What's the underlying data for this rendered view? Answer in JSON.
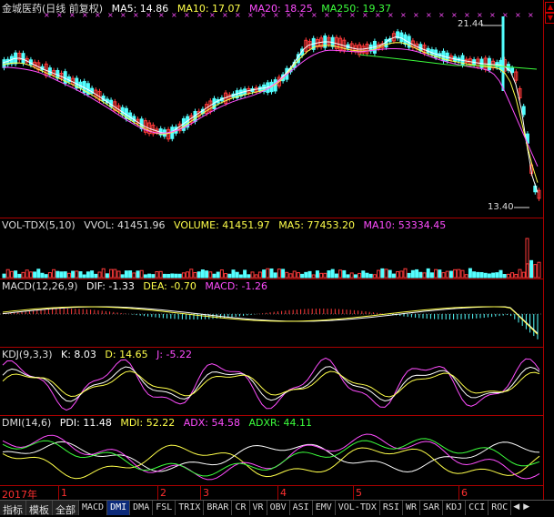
{
  "main_panel": {
    "stock_name": "金城医药(日线 前复权)",
    "ma5": "MA5: 14.86",
    "ma10": "MA10: 17.07",
    "ma20": "MA20: 18.25",
    "ma250": "MA250: 19.37",
    "high_label": "21.44",
    "low_label": "13.40"
  },
  "vol_panel": {
    "name": "VOL-TDX(5,10)",
    "vvol": "VVOL: 41451.96",
    "volume": "VOLUME: 41451.97",
    "ma5": "MA5: 77453.20",
    "ma10": "MA10: 53334.45"
  },
  "macd_panel": {
    "name": "MACD(12,26,9)",
    "dif": "DIF: -1.33",
    "dea": "DEA: -0.70",
    "macd": "MACD: -1.26"
  },
  "kdj_panel": {
    "name": "KDJ(9,3,3)",
    "k": "K: 8.03",
    "d": "D: 14.65",
    "j": "J: -5.22"
  },
  "dmi_panel": {
    "name": "DMI(14,6)",
    "pdi": "PDI: 11.48",
    "mdi": "MDI: 52.22",
    "adx": "ADX: 54.58",
    "adxr": "ADXR: 44.11"
  },
  "date_axis": [
    "2017年",
    "1",
    "2",
    "3",
    "4",
    "5",
    "6"
  ],
  "tabs": [
    "指标",
    "模板",
    "全部",
    "MACD",
    "DMI",
    "DMA",
    "FSL",
    "TRIX",
    "BRAR",
    "CR",
    "VR",
    "OBV",
    "ASI",
    "EMV",
    "VOL-TDX",
    "RSI",
    "WR",
    "SAR",
    "KDJ",
    "CCI",
    "ROC"
  ],
  "active_tab": "DMI",
  "colors": {
    "up": "#ff3a3a",
    "down": "#54ffff",
    "ma5": "#ffffff",
    "ma10": "#ffff4a",
    "ma20": "#ff4dff",
    "ma250": "#3cff3c",
    "grid": "#aa0000"
  },
  "icons": {
    "right_arrow_up": "chevron-up-icon",
    "right_arrow_down": "chevron-down-icon",
    "tab_prev": "triangle-left-icon",
    "tab_next": "triangle-right-icon"
  }
}
